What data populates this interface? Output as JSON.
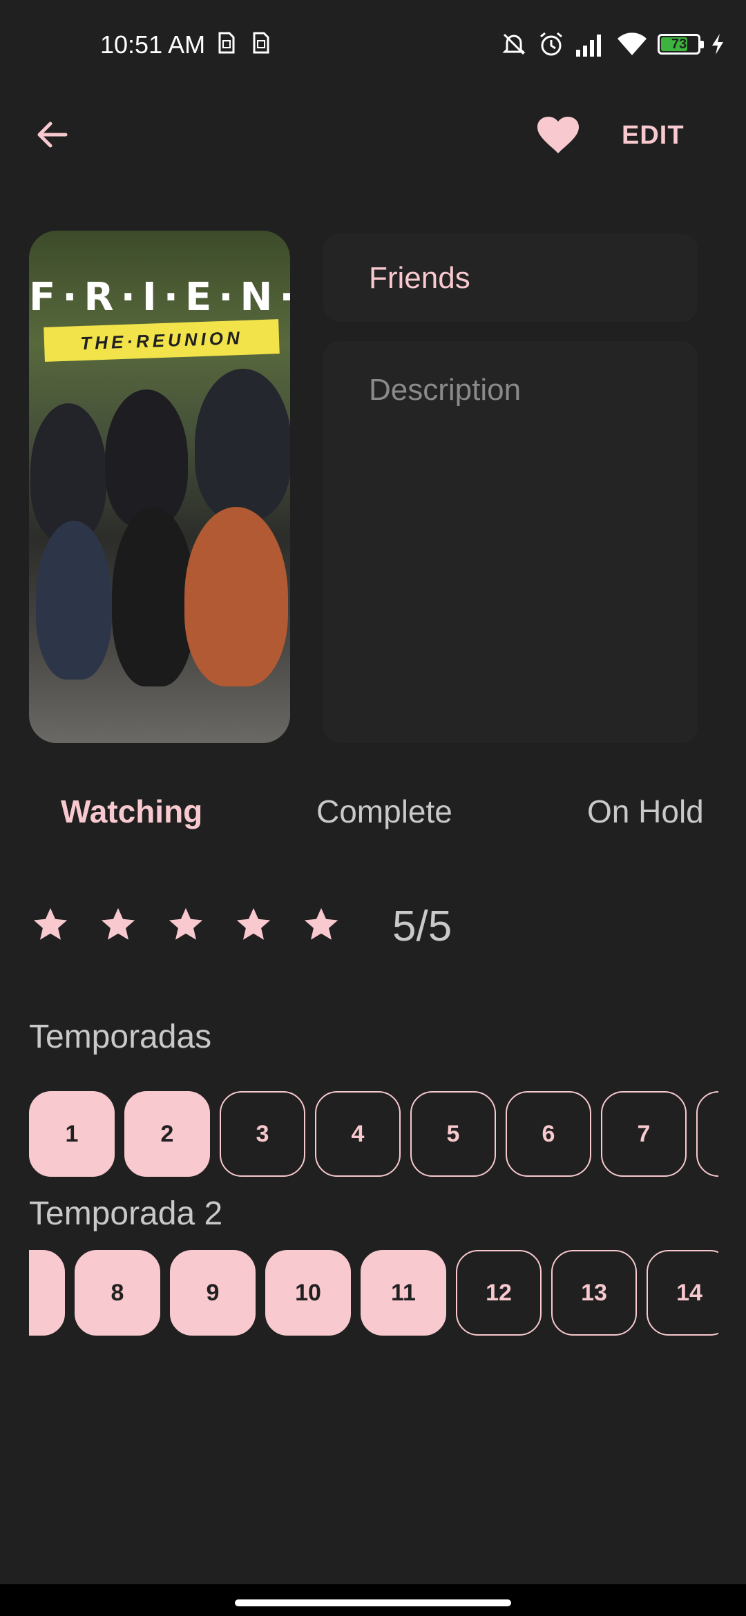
{
  "status_bar": {
    "time": "10:51 AM",
    "battery_level": "73",
    "battery_fraction": 0.73,
    "icons": [
      "sim-icon",
      "sim-icon",
      "mute-icon",
      "alarm-icon",
      "signal-icon",
      "wifi-icon",
      "battery-icon",
      "charging-icon"
    ]
  },
  "app_bar": {
    "back_icon": "arrow-left-icon",
    "favorite_icon": "heart-icon",
    "edit_label": "EDIT"
  },
  "poster": {
    "title_text": "F·R·I·E·N·D·S",
    "subtitle_text": "THE·REUNION"
  },
  "fields": {
    "title_value": "Friends",
    "description_placeholder": "Description"
  },
  "status_tabs": [
    {
      "label": "Watching",
      "active": true
    },
    {
      "label": "Complete",
      "active": false
    },
    {
      "label": "On Hold",
      "active": false
    }
  ],
  "rating": {
    "stars": 5,
    "max": 5,
    "label": "5/5"
  },
  "seasons": {
    "label": "Temporadas",
    "chips": [
      "1",
      "2",
      "3",
      "4",
      "5",
      "6",
      "7"
    ],
    "selected": [
      "1",
      "2"
    ]
  },
  "episodes": {
    "label": "Temporada 2",
    "chips": [
      "8",
      "9",
      "10",
      "11",
      "12",
      "13",
      "14"
    ],
    "selected": [
      "8",
      "9",
      "10",
      "11"
    ]
  },
  "colors": {
    "background": "#202020",
    "accent": "#f8c9ce",
    "field": "#242424"
  }
}
